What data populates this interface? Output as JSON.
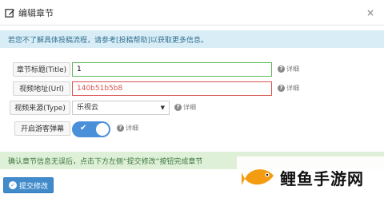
{
  "header": {
    "title": "编辑章节",
    "close_label": "×"
  },
  "info_alert": "若您不了解具体投稿流程，请参考[投稿帮助]以获取更多信息。",
  "form": {
    "title": {
      "label": "章节标题(Title)",
      "value": "1",
      "help": "详细"
    },
    "url": {
      "label": "视频地址(Url)",
      "value": "140b51b5b8",
      "help": "详细"
    },
    "type": {
      "label": "视频来源(Type)",
      "value": "乐视云",
      "help": "详细"
    },
    "danmaku": {
      "label": "开启游客弹幕",
      "enabled": true,
      "help": "详细"
    }
  },
  "success_alert": "确认章节信息无误后，点击下方左侧“提交修改”按钮完成章节",
  "submit_label": "提交修改",
  "watermark": {
    "text": "鲤鱼手游网"
  },
  "colors": {
    "primary": "#428bca",
    "success_border": "#5cb85c",
    "error": "#d9534f",
    "toggle": "#4a90d9",
    "fish": "#f39c12"
  }
}
